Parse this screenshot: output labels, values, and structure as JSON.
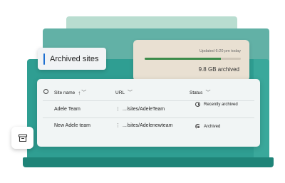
{
  "pill": {
    "label": "Archived sites"
  },
  "storage": {
    "updated": "Updated 6:20 pm today",
    "used_label": "9.8 GB archived",
    "progress_fraction": 0.79
  },
  "table": {
    "columns": {
      "site_name": "Site name",
      "url": "URL",
      "status": "Status"
    },
    "rows": [
      {
        "name": "Adele Team",
        "url": ".../sites/AdeleTeam",
        "status": "Recently archived",
        "status_icon": "clock-icon"
      },
      {
        "name": "New Adele team",
        "url": ".../sites/Adelenewteam",
        "status": "Archived",
        "status_icon": "archive-status-icon"
      }
    ]
  },
  "icons": {
    "tile": "archive-box-icon"
  },
  "colors": {
    "accent": "#1e6fd0",
    "teal": "#2f9e92",
    "progress": "#3c8b4a",
    "storage_card": "#e9e0d2"
  }
}
